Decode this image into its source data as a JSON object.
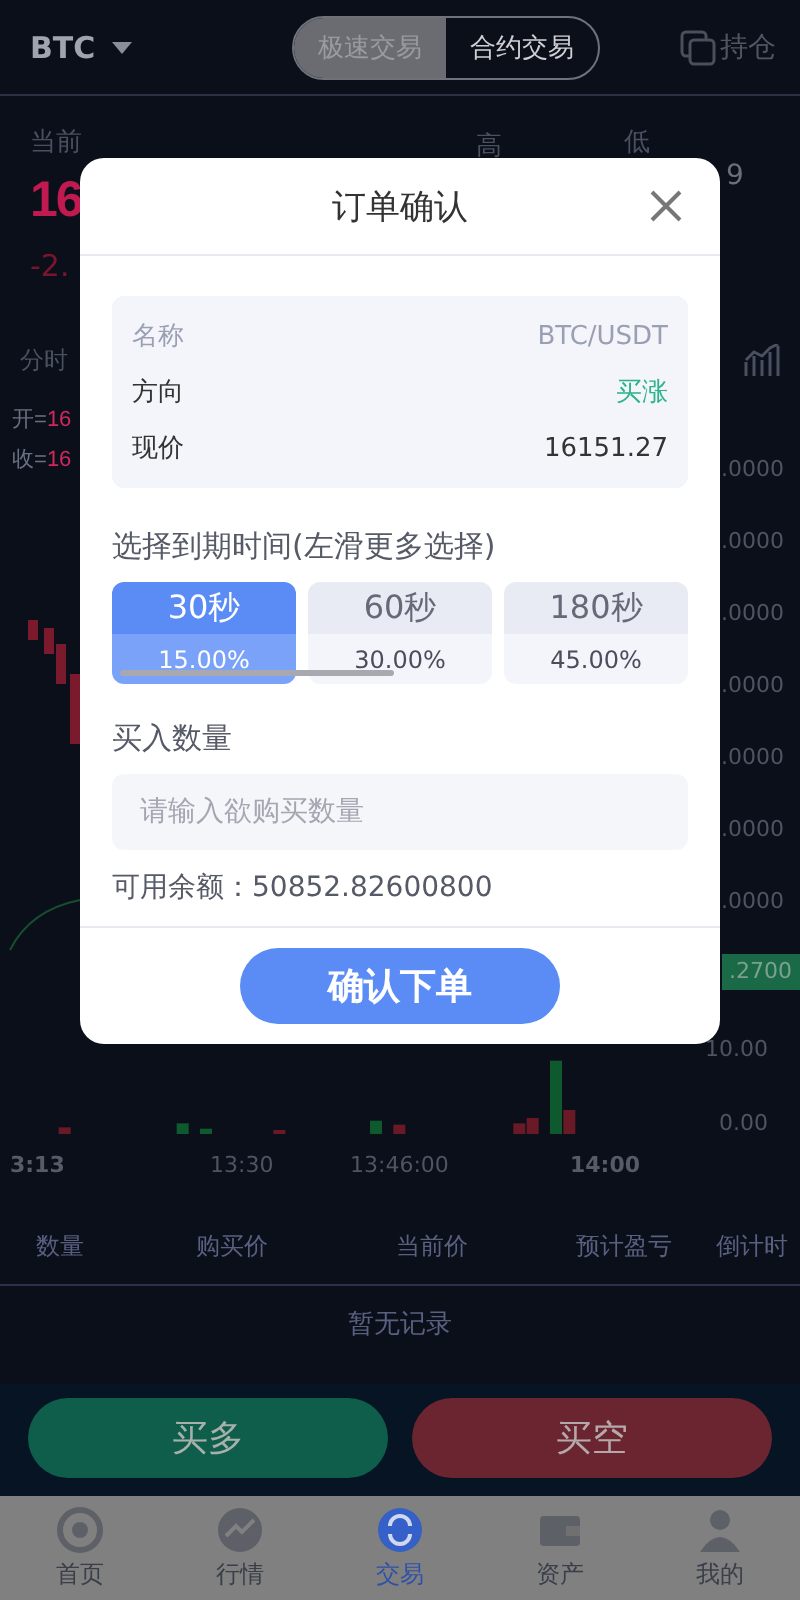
{
  "header": {
    "symbol": "BTC",
    "mode_tabs": [
      {
        "label": "极速交易",
        "selected": true
      },
      {
        "label": "合约交易",
        "selected": false
      }
    ],
    "positions_link": "持仓"
  },
  "quote": {
    "current_label": "当前",
    "price": "16",
    "change": "-2.",
    "high_label": "高",
    "low_label": "低",
    "low_value": "9"
  },
  "chart_header": {
    "interval": "分时"
  },
  "ohlc": [
    {
      "label": "开=",
      "value": "16"
    },
    {
      "label": "收=",
      "value": "16"
    }
  ],
  "price_axis": [
    ".0000",
    ".0000",
    ".0000",
    ".0000",
    ".0000",
    ".0000",
    ".0000"
  ],
  "last_price_tag": ".2700",
  "volume_axis": [
    "10.00",
    "0.00"
  ],
  "time_axis": [
    "3:13",
    "13:30",
    "13:46:00",
    "14:00"
  ],
  "orders_table": {
    "columns": [
      "数量",
      "购买价",
      "当前价",
      "预计盈亏",
      "倒计时"
    ],
    "empty_text": "暂无记录"
  },
  "trade_buttons": [
    {
      "label": "买多",
      "kind": "long"
    },
    {
      "label": "买空",
      "kind": "short"
    }
  ],
  "tab_bar": [
    {
      "label": "首页",
      "selected": false
    },
    {
      "label": "行情",
      "selected": false
    },
    {
      "label": "交易",
      "selected": true
    },
    {
      "label": "资产",
      "selected": false
    },
    {
      "label": "我的",
      "selected": false
    }
  ],
  "modal": {
    "title": "订单确认",
    "info": [
      {
        "label": "名称",
        "value": "BTC/USDT",
        "kind": "muted"
      },
      {
        "label": "方向",
        "value": "买涨",
        "kind": "up"
      },
      {
        "label": "现价",
        "value": "16151.27",
        "kind": "plain"
      }
    ],
    "expiry_label": "选择到期时间(左滑更多选择)",
    "expiry_options": [
      {
        "duration": "30秒",
        "rate": "15.00%",
        "selected": true
      },
      {
        "duration": "60秒",
        "rate": "30.00%",
        "selected": false
      },
      {
        "duration": "180秒",
        "rate": "45.00%",
        "selected": false
      }
    ],
    "amount_label": "买入数量",
    "amount_field": {
      "placeholder": "请输入欲购买数量"
    },
    "balance": "可用余额：50852.82600800",
    "confirm_button": "确认下单"
  }
}
